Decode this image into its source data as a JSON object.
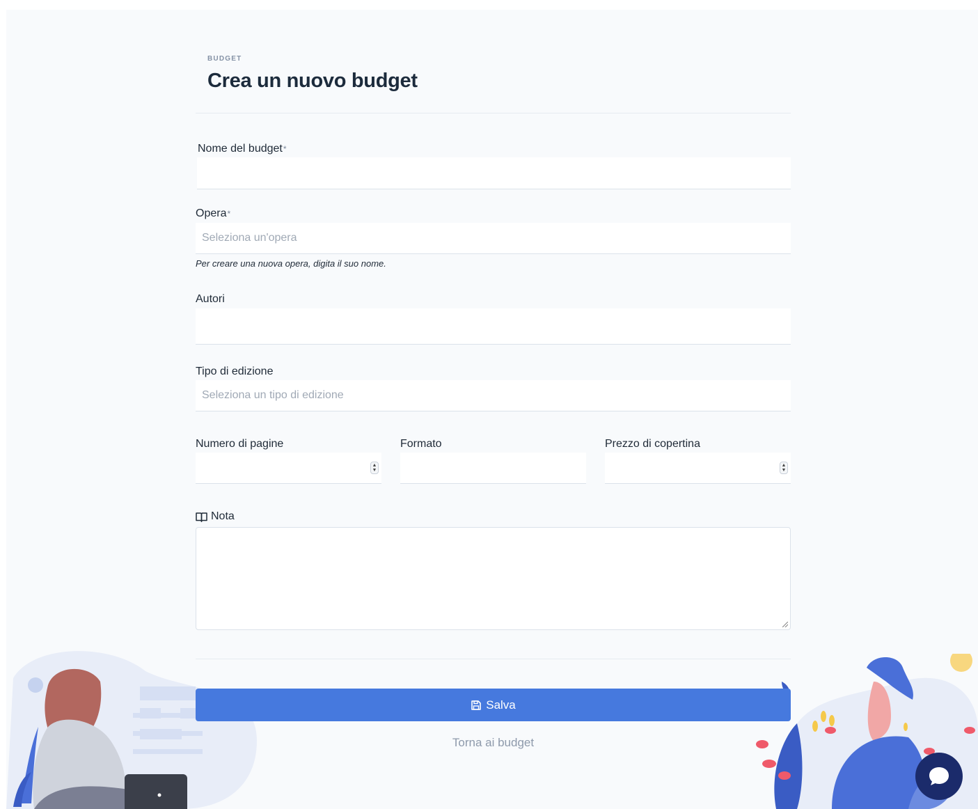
{
  "header": {
    "pretitle": "BUDGET",
    "title": "Crea un nuovo budget"
  },
  "form": {
    "nome": {
      "label": "Nome del budget",
      "required_mark": "*",
      "value": ""
    },
    "opera": {
      "label": "Opera",
      "required_mark": "*",
      "placeholder": "Seleziona un'opera",
      "help": "Per creare una nuova opera, digita il suo nome."
    },
    "autori": {
      "label": "Autori",
      "value": ""
    },
    "tipo_edizione": {
      "label": "Tipo di edizione",
      "placeholder": "Seleziona un tipo di edizione"
    },
    "numero_pagine": {
      "label": "Numero di pagine",
      "value": ""
    },
    "formato": {
      "label": "Formato",
      "value": ""
    },
    "prezzo": {
      "label": "Prezzo di copertina",
      "value": ""
    },
    "nota": {
      "label": "Nota",
      "icon": "book-open-icon",
      "value": ""
    }
  },
  "actions": {
    "save_label": "Salva",
    "save_icon": "floppy-disk-icon",
    "back_label": "Torna ai budget"
  },
  "colors": {
    "accent": "#4679de",
    "background": "#f8fafc",
    "chat": "#1b2b6b"
  }
}
